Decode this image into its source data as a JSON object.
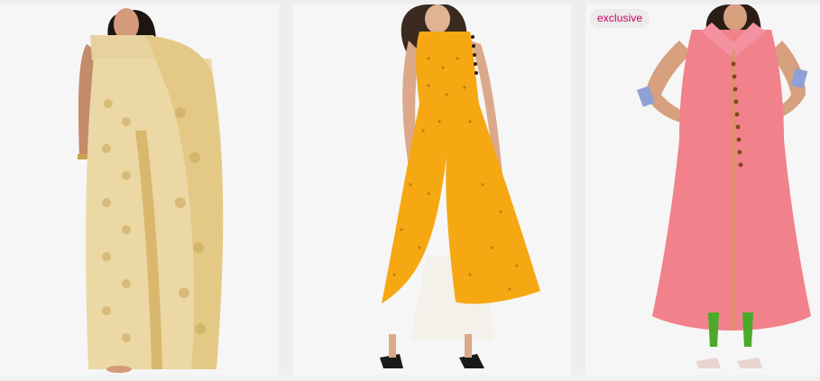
{
  "products": [
    {
      "name": "cream-silk-saree",
      "badge": ""
    },
    {
      "name": "mustard-polka-kurta",
      "badge": ""
    },
    {
      "name": "pink-button-kurta",
      "badge": "exclusive"
    }
  ],
  "colors": {
    "badge_text": "#c4005c",
    "badge_bg": "#ececec",
    "card_bg": "#f6f6f6",
    "page_bg": "#eeeeef"
  }
}
